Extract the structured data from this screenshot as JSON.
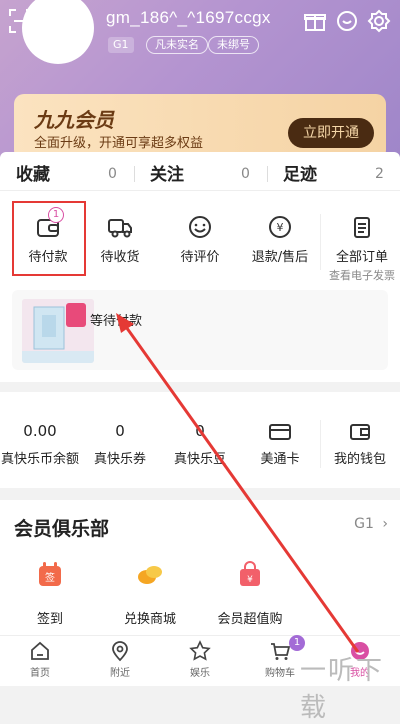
{
  "header": {
    "username": "gm_186^_^1697ccgx",
    "level": "G1",
    "tags": [
      "凡未实名",
      "未绑号"
    ]
  },
  "vip": {
    "title": "九九会员",
    "subtitle": "全面升级，开通可享超多权益",
    "button": "立即开通"
  },
  "stats": [
    {
      "label": "收藏",
      "count": "0"
    },
    {
      "label": "关注",
      "count": "0"
    },
    {
      "label": "足迹",
      "count": "2"
    }
  ],
  "orders": {
    "items": [
      {
        "label": "待付款",
        "badge": "1",
        "icon": "wallet-icon"
      },
      {
        "label": "待收货",
        "icon": "truck-icon"
      },
      {
        "label": "待评价",
        "icon": "smile-icon"
      },
      {
        "label": "退款/售后",
        "icon": "refund-icon"
      }
    ],
    "all_label": "全部订单",
    "all_sub": "查看电子发票"
  },
  "pending": {
    "text": "等待付款"
  },
  "wallet": [
    {
      "value": "0.00",
      "label": "真快乐币余额"
    },
    {
      "value": "0",
      "label": "真快乐券"
    },
    {
      "value": "0",
      "label": "真快乐豆"
    },
    {
      "label": "美通卡",
      "icon": "card-icon"
    },
    {
      "label": "我的钱包",
      "icon": "wallet-icon"
    }
  ],
  "club": {
    "title": "会员俱乐部",
    "level": "G1",
    "items": [
      {
        "label": "签到",
        "icon": "calendar-icon"
      },
      {
        "label": "兑换商城",
        "icon": "egg-icon"
      },
      {
        "label": "会员超值购",
        "icon": "shopping-bag-icon"
      }
    ]
  },
  "tabs": [
    {
      "label": "首页",
      "icon": "home-icon"
    },
    {
      "label": "附近",
      "icon": "location-icon"
    },
    {
      "label": "娱乐",
      "icon": "star-icon"
    },
    {
      "label": "购物车",
      "icon": "cart-icon",
      "badge": "1"
    },
    {
      "label": "我的",
      "icon": "profile-icon",
      "active": true
    }
  ],
  "watermark": "一听下载",
  "colors": {
    "accent": "#d94fa3",
    "highlight": "#e53935",
    "vip_dark": "#4a2b12"
  }
}
